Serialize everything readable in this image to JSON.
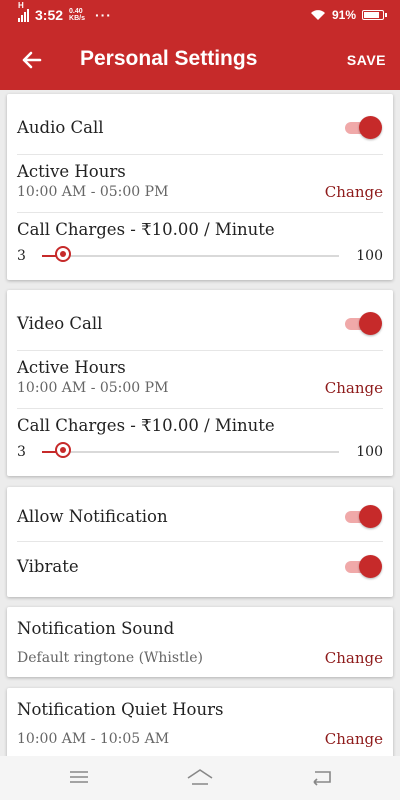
{
  "status_bar": {
    "network": "H",
    "time": "3:52",
    "speed_value": "0.40",
    "speed_unit": "KB/s",
    "dots": "···",
    "battery_text": "91%",
    "battery_level": 0.91
  },
  "app_bar": {
    "title": "Personal Settings",
    "save_label": "SAVE"
  },
  "audio_call": {
    "label": "Audio Call",
    "enabled": true,
    "active_hours_label": "Active Hours",
    "active_hours_value": "10:00 AM - 05:00 PM",
    "change_label": "Change",
    "charges_label": "Call Charges - ₹10.00 / Minute",
    "slider_min": "3",
    "slider_max": "100",
    "slider_value": 10
  },
  "video_call": {
    "label": "Video Call",
    "enabled": true,
    "active_hours_label": "Active Hours",
    "active_hours_value": "10:00 AM - 05:00 PM",
    "change_label": "Change",
    "charges_label": "Call Charges - ₹10.00 / Minute",
    "slider_min": "3",
    "slider_max": "100",
    "slider_value": 10
  },
  "notifications": {
    "allow_label": "Allow Notification",
    "allow_enabled": true,
    "vibrate_label": "Vibrate",
    "vibrate_enabled": true
  },
  "notification_sound": {
    "label": "Notification Sound",
    "value": "Default ringtone (Whistle)",
    "change_label": "Change"
  },
  "quiet_hours": {
    "label": "Notification Quiet Hours",
    "value": "10:00 AM - 10:05 AM",
    "change_label": "Change"
  },
  "nav_bar": {
    "icons": [
      "menu-icon",
      "home-icon",
      "back-icon"
    ]
  },
  "colors": {
    "accent": "#c62a2a",
    "accent_light": "#f0a9a9",
    "link": "#8e1b1b"
  }
}
